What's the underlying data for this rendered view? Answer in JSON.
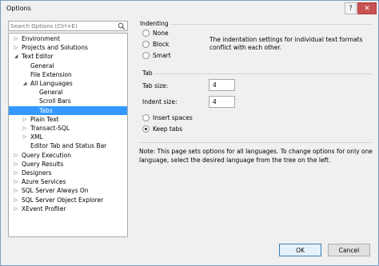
{
  "window": {
    "title": "Options",
    "help_label": "?",
    "close_label": "✕"
  },
  "search": {
    "placeholder": "Search Options (Ctrl+E)",
    "icon": "search-icon"
  },
  "tree": {
    "items": [
      {
        "label": "Environment",
        "expander": "collapsed",
        "level": 0
      },
      {
        "label": "Projects and Solutions",
        "expander": "collapsed",
        "level": 0
      },
      {
        "label": "Text Editor",
        "expander": "expanded",
        "level": 0
      },
      {
        "label": "General",
        "expander": "none",
        "level": 1
      },
      {
        "label": "File Extension",
        "expander": "none",
        "level": 1
      },
      {
        "label": "All Languages",
        "expander": "expanded",
        "level": 1
      },
      {
        "label": "General",
        "expander": "none",
        "level": 2
      },
      {
        "label": "Scroll Bars",
        "expander": "none",
        "level": 2
      },
      {
        "label": "Tabs",
        "expander": "none",
        "level": 2,
        "selected": true
      },
      {
        "label": "Plain Text",
        "expander": "collapsed",
        "level": 1
      },
      {
        "label": "Transact-SQL",
        "expander": "collapsed",
        "level": 1
      },
      {
        "label": "XML",
        "expander": "collapsed",
        "level": 1
      },
      {
        "label": "Editor Tab and Status Bar",
        "expander": "none",
        "level": 1
      },
      {
        "label": "Query Execution",
        "expander": "collapsed",
        "level": 0
      },
      {
        "label": "Query Results",
        "expander": "collapsed",
        "level": 0
      },
      {
        "label": "Designers",
        "expander": "collapsed",
        "level": 0
      },
      {
        "label": "Azure Services",
        "expander": "collapsed",
        "level": 0
      },
      {
        "label": "SQL Server Always On",
        "expander": "collapsed",
        "level": 0
      },
      {
        "label": "SQL Server Object Explorer",
        "expander": "collapsed",
        "level": 0
      },
      {
        "label": "XEvent Profiler",
        "expander": "collapsed",
        "level": 0
      }
    ]
  },
  "indenting": {
    "title": "Indenting",
    "options": [
      {
        "label": "None",
        "checked": false
      },
      {
        "label": "Block",
        "checked": false
      },
      {
        "label": "Smart",
        "checked": false
      }
    ],
    "description": "The indentation settings for individual text formats conflict with each other."
  },
  "tab": {
    "title": "Tab",
    "tab_size_label": "Tab size:",
    "tab_size_value": "4",
    "indent_size_label": "Indent size:",
    "indent_size_value": "4",
    "options": [
      {
        "label": "Insert spaces",
        "checked": false
      },
      {
        "label": "Keep tabs",
        "checked": true
      }
    ]
  },
  "note": "Note: This page sets options for all languages. To change options for only one language, select the desired language from the tree on the left.",
  "buttons": {
    "ok": "OK",
    "cancel": "Cancel"
  }
}
